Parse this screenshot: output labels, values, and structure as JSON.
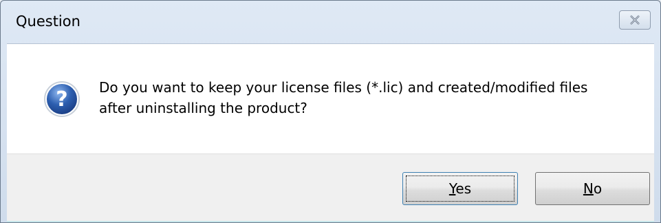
{
  "window": {
    "title": "Question",
    "close_icon": "close-icon"
  },
  "dialog": {
    "icon": "question-icon",
    "message_line1": "Do you want to keep your license files (*.lic) and created/modified files",
    "message_line2": "after uninstalling the product?"
  },
  "buttons": {
    "yes_accel": "Y",
    "yes_rest": "es",
    "no_accel": "N",
    "no_rest": "o"
  },
  "colors": {
    "title_gradient_top": "#dfe9f5",
    "content_bg": "#ffffff",
    "footer_bg": "#f0f0f0",
    "default_button_border": "#3c7fb1",
    "question_icon_blue": "#2d5fb0"
  }
}
